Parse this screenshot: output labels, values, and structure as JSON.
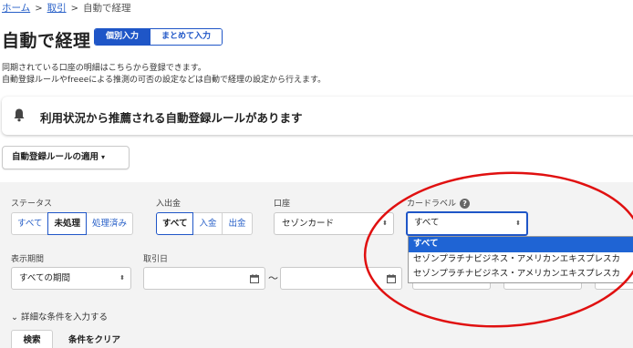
{
  "breadcrumb": {
    "home": "ホーム",
    "transactions": "取引",
    "current": "自動で経理",
    "separator": ">"
  },
  "page": {
    "title": "自動で経理"
  },
  "mode_toggle": {
    "individual": "個別入力",
    "bulk": "まとめて入力"
  },
  "description": {
    "line1": "同期されている口座の明細はこちらから登録できます。",
    "line2": "自動登録ルールやfreeeによる推測の可否の設定などは自動で経理の設定から行えます。"
  },
  "notice": {
    "text": "利用状況から推薦される自動登録ルールがあります",
    "icon": "bell-icon"
  },
  "rule_button": {
    "label": "自動登録ルールの適用",
    "caret": "▾"
  },
  "filters": {
    "status": {
      "label": "ステータス",
      "options": [
        "すべて",
        "未処理",
        "処理済み"
      ],
      "selected": "未処理"
    },
    "in_out": {
      "label": "入出金",
      "options": [
        "すべて",
        "入金",
        "出金"
      ],
      "selected": "すべて"
    },
    "account": {
      "label": "口座",
      "value": "セゾンカード"
    },
    "card_label": {
      "label": "カードラベル",
      "help_icon": "?",
      "value": "すべて",
      "options": [
        "すべて",
        "セゾンプラチナビジネス・アメリカンエキスプレスカ",
        "セゾンプラチナビジネス・アメリカンエキスプレスカ"
      ]
    },
    "period": {
      "label": "表示期間",
      "value": "すべての期間"
    },
    "transaction_date": {
      "label": "取引日",
      "from": "",
      "to": "",
      "separator": "〜"
    },
    "detail_toggle": "詳細な条件を入力する",
    "detail_chevron": "⌄",
    "search": "検索",
    "clear": "条件をクリア"
  },
  "select_arrows": "⬍",
  "colors": {
    "primary": "#1f56c7",
    "link": "#2860c8",
    "annotation": "#e01010"
  }
}
